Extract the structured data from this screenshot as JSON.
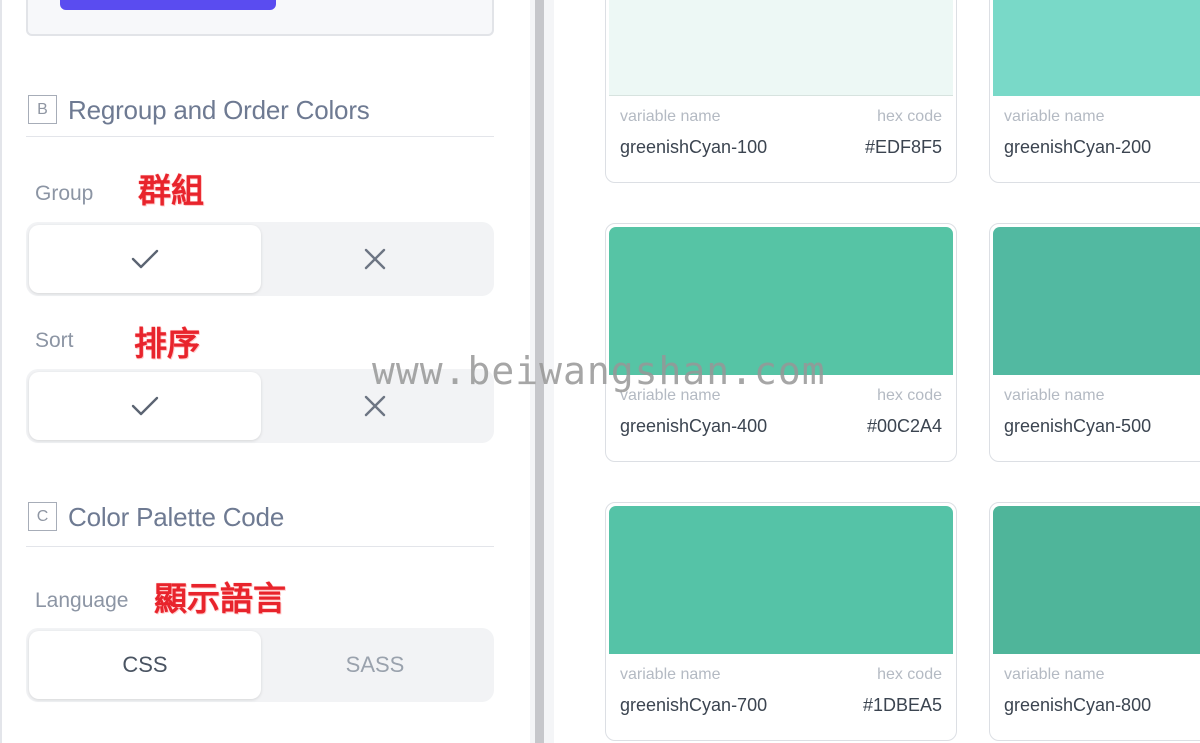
{
  "regroup_section": {
    "letter": "B",
    "title": "Regroup and Order Colors",
    "group": {
      "label": "Group",
      "note": "群組",
      "selected": "check"
    },
    "sort": {
      "label": "Sort",
      "note": "排序",
      "selected": "check"
    },
    "options_icons": [
      "check-icon",
      "close-icon"
    ]
  },
  "code_section": {
    "letter": "C",
    "title": "Color Palette Code",
    "language": {
      "label": "Language",
      "note": "顯示語言",
      "options": [
        "CSS",
        "SASS"
      ],
      "selected": "CSS"
    }
  },
  "colors": {
    "accent": "#5a4cf0",
    "note_red": "#e8242c"
  },
  "palette": [
    {
      "name": "greenishCyan-100",
      "hex": "#EDF8F5",
      "swatch": "#EDF8F5",
      "name_label": "variable name",
      "hex_label": "hex code"
    },
    {
      "name": "greenishCyan-200",
      "hex": "",
      "swatch": "#79D9C8",
      "name_label": "variable name",
      "hex_label": ""
    },
    {
      "name": "greenishCyan-400",
      "hex": "#00C2A4",
      "swatch": "#56C4A5",
      "name_label": "variable name",
      "hex_label": "hex code"
    },
    {
      "name": "greenishCyan-500",
      "hex": "",
      "swatch": "#52B9A1",
      "name_label": "variable name",
      "hex_label": ""
    },
    {
      "name": "greenishCyan-700",
      "hex": "#1DBEA5",
      "swatch": "#55C3A7",
      "name_label": "variable name",
      "hex_label": "hex code"
    },
    {
      "name": "greenishCyan-800",
      "hex": "",
      "swatch": "#4FB59A",
      "name_label": "variable name",
      "hex_label": ""
    }
  ],
  "watermark": "www.beiwangshan.com"
}
